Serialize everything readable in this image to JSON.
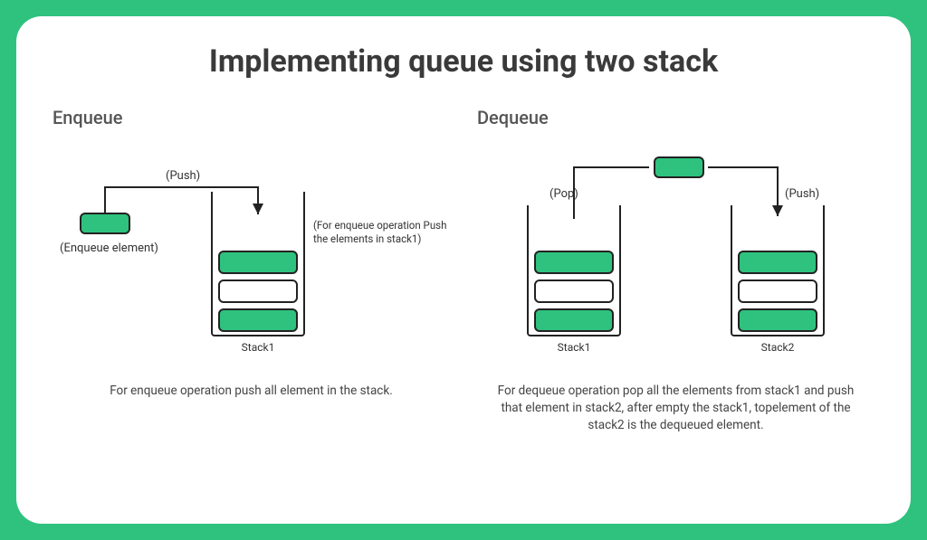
{
  "title": "Implementing queue using two stack",
  "enqueue": {
    "heading": "Enqueue",
    "push_label": "(Push)",
    "element_caption": "(Enqueue element)",
    "side_note": "(For enqueue operation Push the elements in stack1)",
    "stack_label": "Stack1",
    "description": "For enqueue operation push all element in the stack."
  },
  "dequeue": {
    "heading": "Dequeue",
    "pop_label": "(Pop)",
    "push_label": "(Push)",
    "stack1_label": "Stack1",
    "stack2_label": "Stack2",
    "description": "For dequeue operation pop all the elements from stack1 and push that element in stack2, after empty the stack1, topelement of the stack2 is the dequeued element."
  }
}
